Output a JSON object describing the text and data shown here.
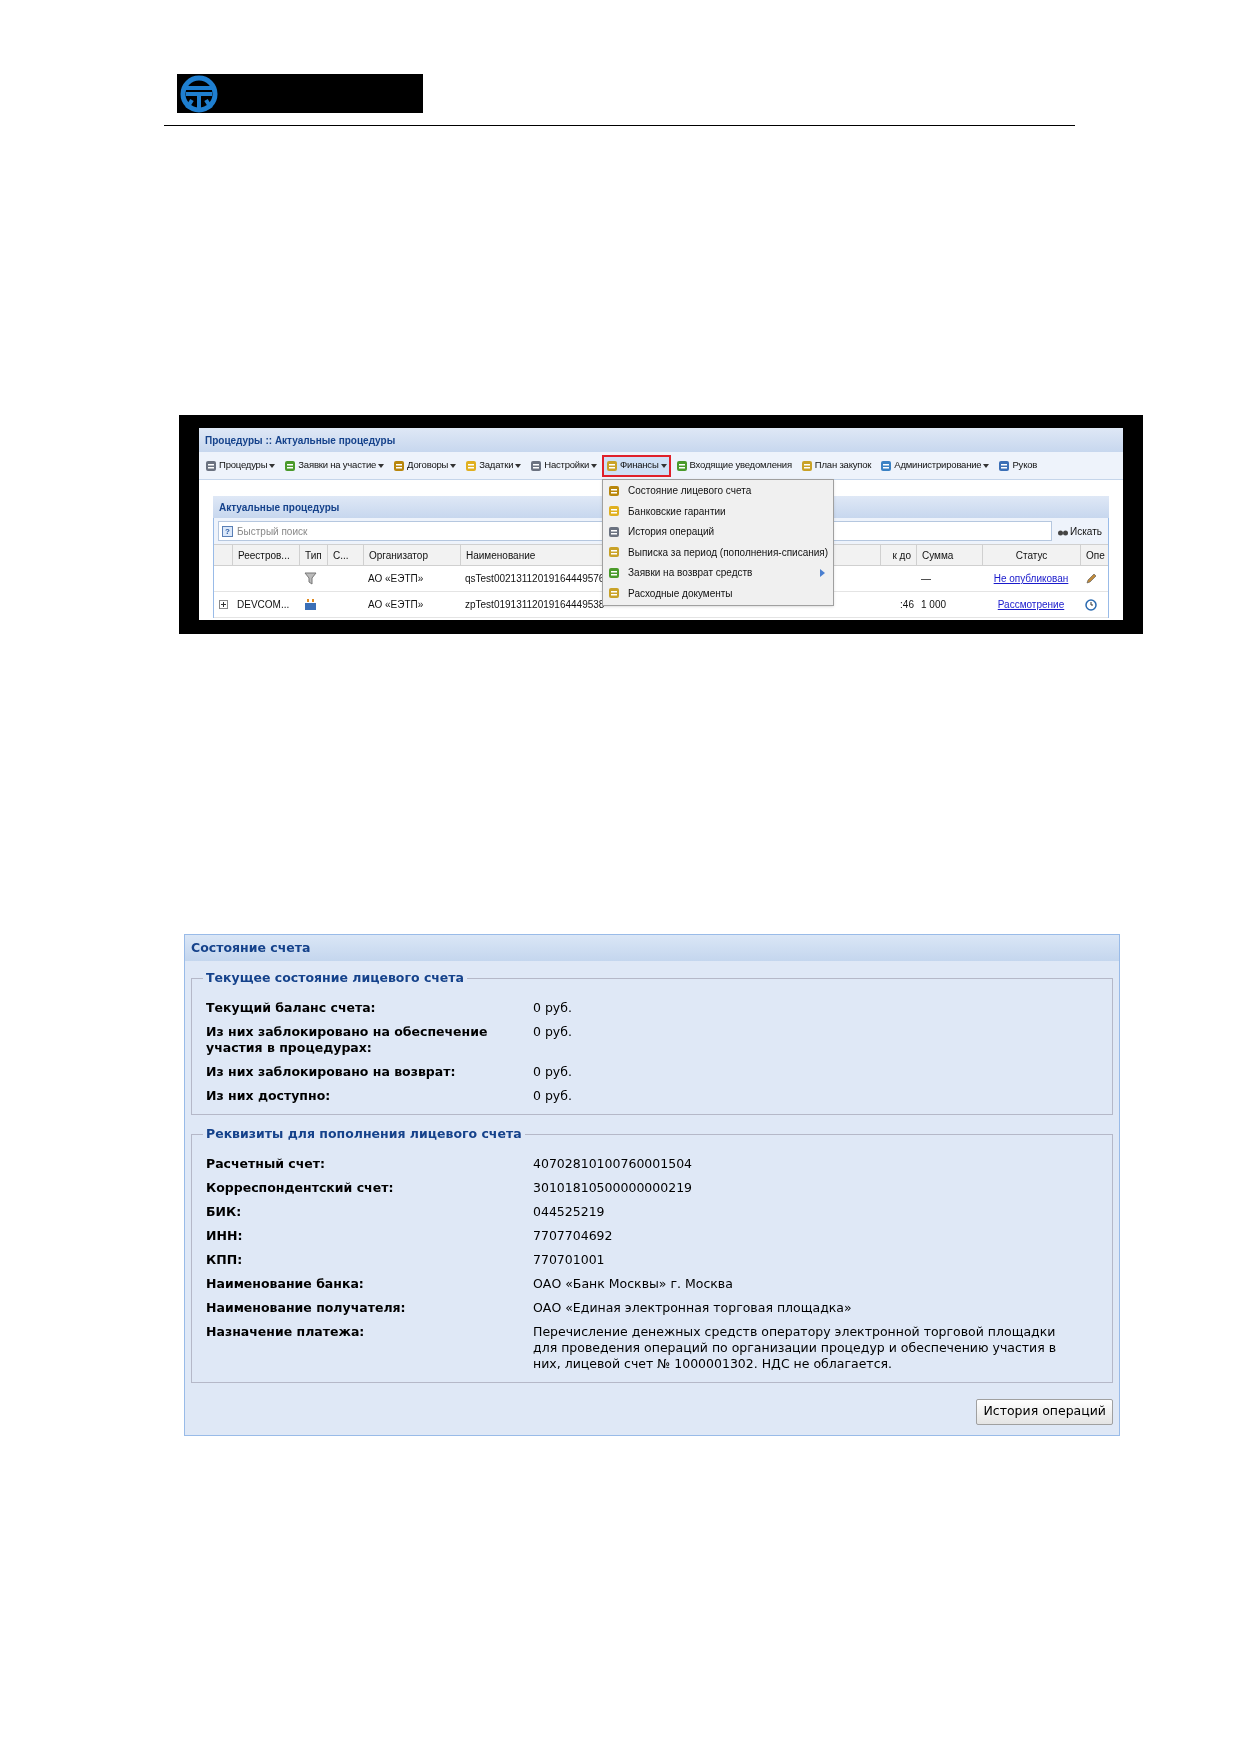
{
  "app_window": {
    "title": "Процедуры :: Актуальные процедуры",
    "toolbar": [
      {
        "label": "Процедуры",
        "dropdown": true,
        "selected": false
      },
      {
        "label": "Заявки на участие",
        "dropdown": true,
        "selected": false
      },
      {
        "label": "Договоры",
        "dropdown": true,
        "selected": false
      },
      {
        "label": "Задатки",
        "dropdown": true,
        "selected": false
      },
      {
        "label": "Настройки",
        "dropdown": true,
        "selected": false
      },
      {
        "label": "Финансы",
        "dropdown": true,
        "selected": true
      },
      {
        "label": "Входящие уведомления",
        "dropdown": false,
        "selected": false
      },
      {
        "label": "План закупок",
        "dropdown": false,
        "selected": false
      },
      {
        "label": "Администрирование",
        "dropdown": true,
        "selected": false
      },
      {
        "label": "Руков",
        "dropdown": false,
        "selected": false
      }
    ],
    "panel": {
      "title": "Актуальные процедуры",
      "search": {
        "help": "?",
        "placeholder": "Быстрый поиск",
        "button": "Искать"
      },
      "columns": [
        "Реестров...",
        "Тип",
        "С...",
        "Организатор",
        "Наименование",
        "к до",
        "Сумма",
        "Статус",
        "Опе"
      ],
      "rows": [
        {
          "expandable": false,
          "registry": "",
          "org": "АО «ЕЭТП»",
          "name": "qsTest00213112019164449576",
          "time": "",
          "sum": "—",
          "status": "Не опубликован"
        },
        {
          "expandable": true,
          "registry": "DEVCOM...",
          "org": "АО «ЕЭТП»",
          "name": "zpTest01913112019164449538",
          "time": ":46",
          "sum": "1 000",
          "status": "Рассмотрение"
        }
      ]
    },
    "menu": {
      "items": [
        {
          "label": "Состояние лицевого счета",
          "submenu": false
        },
        {
          "label": "Банковские гарантии",
          "submenu": false
        },
        {
          "label": "История операций",
          "submenu": false
        },
        {
          "label": "Выписка за период (пополнения-списания)",
          "submenu": false
        },
        {
          "label": "Заявки на возврат средств",
          "submenu": true
        },
        {
          "label": "Расходные документы",
          "submenu": false
        }
      ]
    }
  },
  "account_panel": {
    "title": "Состояние счета",
    "fieldsets": [
      {
        "legend": "Текущее состояние лицевого счета",
        "rows": [
          {
            "label": "Текущий баланс счета:",
            "value": "0 руб."
          },
          {
            "label": "Из них заблокировано на обеспечение участия в процедурах:",
            "value": "0 руб."
          },
          {
            "label": "Из них заблокировано на возврат:",
            "value": "0 руб."
          },
          {
            "label": "Из них доступно:",
            "value": "0 руб."
          }
        ]
      },
      {
        "legend": "Реквизиты для пополнения лицевого счета",
        "rows": [
          {
            "label": "Расчетный счет:",
            "value": "40702810100760001504"
          },
          {
            "label": "Корреспондентский счет:",
            "value": "30101810500000000219"
          },
          {
            "label": "БИК:",
            "value": "044525219"
          },
          {
            "label": "ИНН:",
            "value": "7707704692"
          },
          {
            "label": "КПП:",
            "value": "770701001"
          },
          {
            "label": "Наименование банка:",
            "value": "ОАО «Банк Москвы» г. Москва"
          },
          {
            "label": "Наименование получателя:",
            "value": "ОАО «Единая электронная торговая площадка»"
          },
          {
            "label": "Назначение платежа:",
            "value": "Перечисление денежных средств оператору электронной торговой площадки для проведения операций по организации процедур и обеспечению участия в них, лицевой счет № 1000001302. НДС не облагается."
          }
        ]
      }
    ],
    "button": "История операций"
  }
}
